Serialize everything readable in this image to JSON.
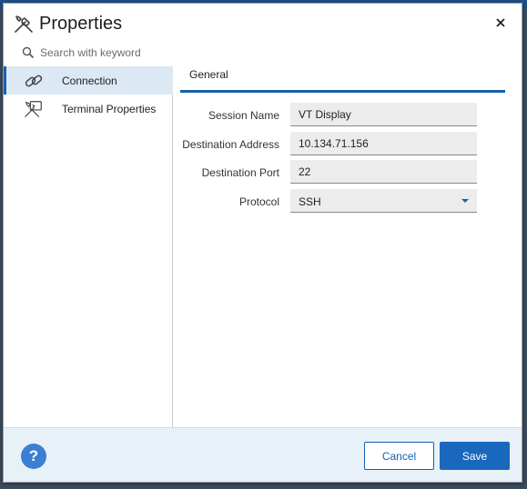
{
  "dialog": {
    "title": "Properties",
    "title_icon": "tools-icon",
    "close_icon": "close-icon"
  },
  "search": {
    "placeholder": "Search with keyword",
    "value": ""
  },
  "sidebar": {
    "items": [
      {
        "label": "Connection",
        "icon": "link-icon",
        "active": true
      },
      {
        "label": "Terminal Properties",
        "icon": "terminal-tools-icon",
        "active": false
      }
    ]
  },
  "tabs": [
    {
      "label": "General",
      "active": true
    }
  ],
  "form": {
    "session_name": {
      "label": "Session Name",
      "value": "VT Display"
    },
    "destination_address": {
      "label": "Destination Address",
      "value": "10.134.71.156"
    },
    "destination_port": {
      "label": "Destination Port",
      "value": "22"
    },
    "protocol": {
      "label": "Protocol",
      "value": "SSH"
    }
  },
  "footer": {
    "help_label": "?",
    "cancel_label": "Cancel",
    "save_label": "Save"
  },
  "colors": {
    "accent": "#1660b0",
    "active_item_bg": "#dce8f3",
    "footer_bg": "#e9f1f8",
    "help_bg": "#3b7fd4"
  }
}
